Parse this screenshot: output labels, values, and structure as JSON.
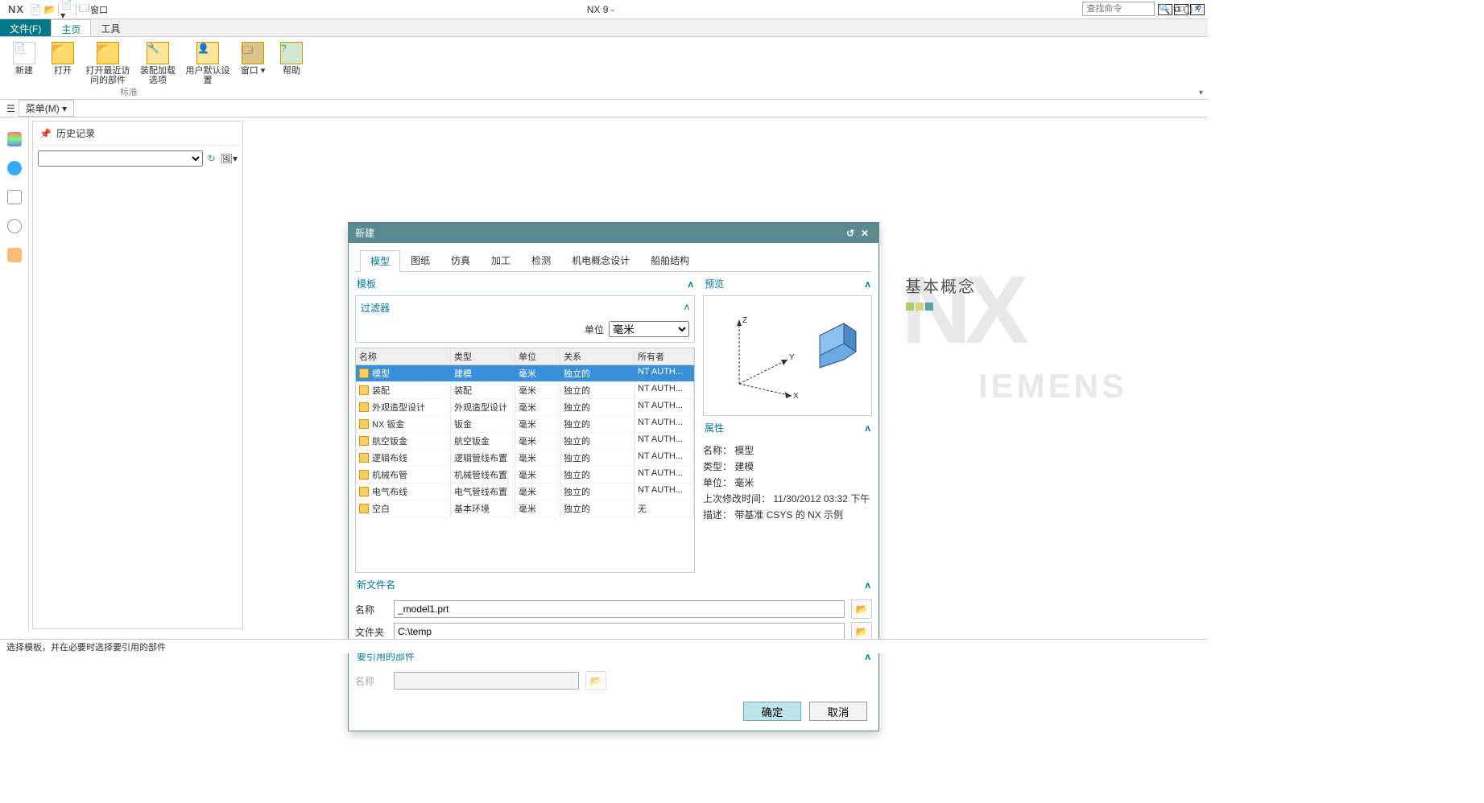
{
  "titlebar": {
    "app": "NX",
    "title": "NX 9 -",
    "brand": "SIEMENS",
    "qat_window": "窗口"
  },
  "tabs": {
    "file": "文件(F)",
    "home": "主页",
    "tools": "工具"
  },
  "ribbon": {
    "group_label": "标准",
    "items": [
      {
        "label": "新建"
      },
      {
        "label": "打开"
      },
      {
        "label": "打开最近访问的部件"
      },
      {
        "label": "装配加载选项"
      },
      {
        "label": "用户默认设置"
      },
      {
        "label": "窗口"
      },
      {
        "label": "帮助"
      }
    ],
    "search_placeholder": "查找命令"
  },
  "menubar": {
    "menu": "菜单(M)"
  },
  "sidebar": {
    "panel_title": "历史记录"
  },
  "watermark": {
    "text": "基本概念"
  },
  "dialog": {
    "title": "新建",
    "tabs": [
      "模型",
      "图纸",
      "仿真",
      "加工",
      "检测",
      "机电概念设计",
      "船舶结构"
    ],
    "active_tab": "模型",
    "section_templates": "模板",
    "section_preview": "预览",
    "filter": {
      "title": "过滤器",
      "unit_label": "单位",
      "unit_value": "毫米"
    },
    "table": {
      "headers": [
        "名称",
        "类型",
        "单位",
        "关系",
        "所有者"
      ],
      "rows": [
        {
          "name": "模型",
          "type": "建模",
          "unit": "毫米",
          "rel": "独立的",
          "owner": "NT AUTH...",
          "sel": true
        },
        {
          "name": "装配",
          "type": "装配",
          "unit": "毫米",
          "rel": "独立的",
          "owner": "NT AUTH..."
        },
        {
          "name": "外观造型设计",
          "type": "外观造型设计",
          "unit": "毫米",
          "rel": "独立的",
          "owner": "NT AUTH..."
        },
        {
          "name": "NX 钣金",
          "type": "钣金",
          "unit": "毫米",
          "rel": "独立的",
          "owner": "NT AUTH..."
        },
        {
          "name": "航空钣金",
          "type": "航空钣金",
          "unit": "毫米",
          "rel": "独立的",
          "owner": "NT AUTH..."
        },
        {
          "name": "逻辑布线",
          "type": "逻辑管线布置",
          "unit": "毫米",
          "rel": "独立的",
          "owner": "NT AUTH..."
        },
        {
          "name": "机械布管",
          "type": "机械管线布置",
          "unit": "毫米",
          "rel": "独立的",
          "owner": "NT AUTH..."
        },
        {
          "name": "电气布线",
          "type": "电气管线布置",
          "unit": "毫米",
          "rel": "独立的",
          "owner": "NT AUTH..."
        },
        {
          "name": "空白",
          "type": "基本环境",
          "unit": "毫米",
          "rel": "独立的",
          "owner": "无"
        }
      ]
    },
    "section_properties": "属性",
    "properties": {
      "name_lbl": "名称：",
      "name_val": "模型",
      "type_lbl": "类型：",
      "type_val": "建模",
      "unit_lbl": "单位：",
      "unit_val": "毫米",
      "mod_lbl": "上次修改时间：",
      "mod_val": "11/30/2012 03:32 下午",
      "desc_lbl": "描述：",
      "desc_val": "带基准 CSYS 的 NX 示例"
    },
    "section_newfile": "新文件名",
    "newfile": {
      "name_lbl": "名称",
      "name_val": "_model1.prt",
      "folder_lbl": "文件夹",
      "folder_val": "C:\\temp"
    },
    "section_ref": "要引用的部件",
    "ref": {
      "name_lbl": "名称"
    },
    "ok": "确定",
    "cancel": "取消"
  },
  "statusbar": "选择模板，并在必要时选择要引用的部件"
}
